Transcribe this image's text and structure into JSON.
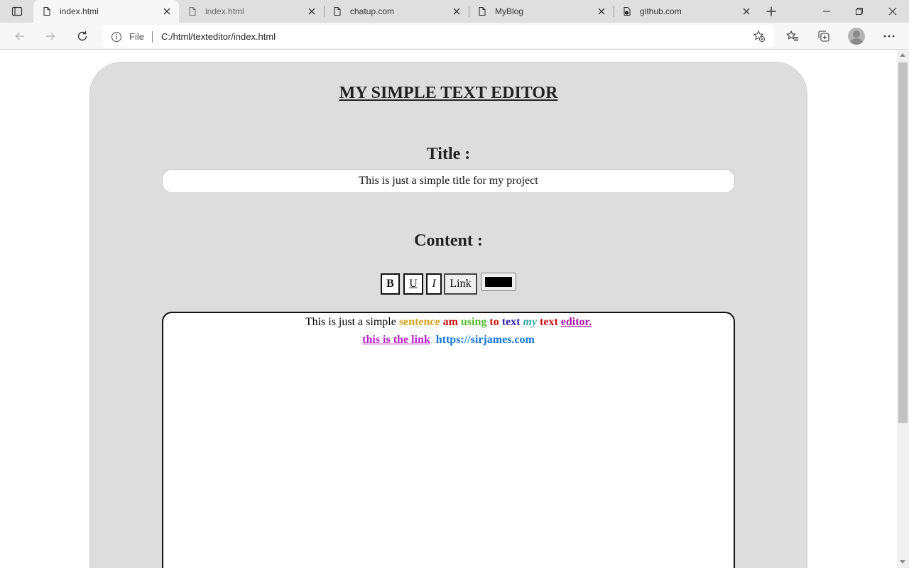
{
  "browser": {
    "tabs": [
      {
        "title": "index.html",
        "active": true
      },
      {
        "title": "index.html",
        "active": false
      },
      {
        "title": "chatup.com",
        "active": false
      },
      {
        "title": "MyBlog",
        "active": false
      },
      {
        "title": "github.com",
        "active": false
      }
    ],
    "address": {
      "scheme": "File",
      "url": "C:/html/texteditor/index.html"
    }
  },
  "page": {
    "heading": "MY SIMPLE TEXT EDITOR",
    "title_label": "Title :",
    "title_value": "This is just a simple title for my project",
    "content_label": "Content :",
    "toolbar": {
      "bold": "B",
      "underline": "U",
      "italic": "I",
      "link": "Link",
      "color_value": "#000000"
    },
    "content": {
      "line1": [
        {
          "text": "This is just a simple ",
          "color": "#000000",
          "bold": false,
          "italic": false,
          "underline": false
        },
        {
          "text": "sentence",
          "color": "#d4a017",
          "bold": true,
          "italic": false,
          "underline": false
        },
        {
          "text": " ",
          "color": "#000000",
          "bold": false,
          "italic": false,
          "underline": false
        },
        {
          "text": "am",
          "color": "#cc1111",
          "bold": true,
          "italic": false,
          "underline": false
        },
        {
          "text": " ",
          "color": "#000000",
          "bold": false,
          "italic": false,
          "underline": false
        },
        {
          "text": "using",
          "color": "#55bb33",
          "bold": true,
          "italic": false,
          "underline": false
        },
        {
          "text": " ",
          "color": "#000000",
          "bold": false,
          "italic": false,
          "underline": false
        },
        {
          "text": "to",
          "color": "#cc1111",
          "bold": true,
          "italic": false,
          "underline": false
        },
        {
          "text": " ",
          "color": "#000000",
          "bold": false,
          "italic": false,
          "underline": false
        },
        {
          "text": "text",
          "color": "#3322aa",
          "bold": true,
          "italic": false,
          "underline": false
        },
        {
          "text": " ",
          "color": "#000000",
          "bold": false,
          "italic": false,
          "underline": false
        },
        {
          "text": "my",
          "color": "#33aaaa",
          "bold": true,
          "italic": true,
          "underline": false
        },
        {
          "text": " ",
          "color": "#000000",
          "bold": false,
          "italic": false,
          "underline": false
        },
        {
          "text": "text",
          "color": "#cc1111",
          "bold": true,
          "italic": false,
          "underline": false
        },
        {
          "text": " ",
          "color": "#000000",
          "bold": false,
          "italic": false,
          "underline": false
        },
        {
          "text": "editor.",
          "color": "#aa11aa",
          "bold": true,
          "italic": false,
          "underline": true
        }
      ],
      "line2": [
        {
          "text": "this is the link",
          "color": "#bb22cc",
          "bold": true,
          "italic": false,
          "underline": true
        },
        {
          "text": "  ",
          "color": "#000000",
          "bold": false,
          "italic": false,
          "underline": false
        },
        {
          "text": "https://sirjames.com",
          "color": "#1177dd",
          "bold": true,
          "italic": false,
          "underline": false
        }
      ]
    }
  },
  "colors": {
    "card_bg": "#dddddd",
    "tabstrip_bg": "#dfdfdf",
    "toolbar_bg": "#f7f7f7"
  }
}
